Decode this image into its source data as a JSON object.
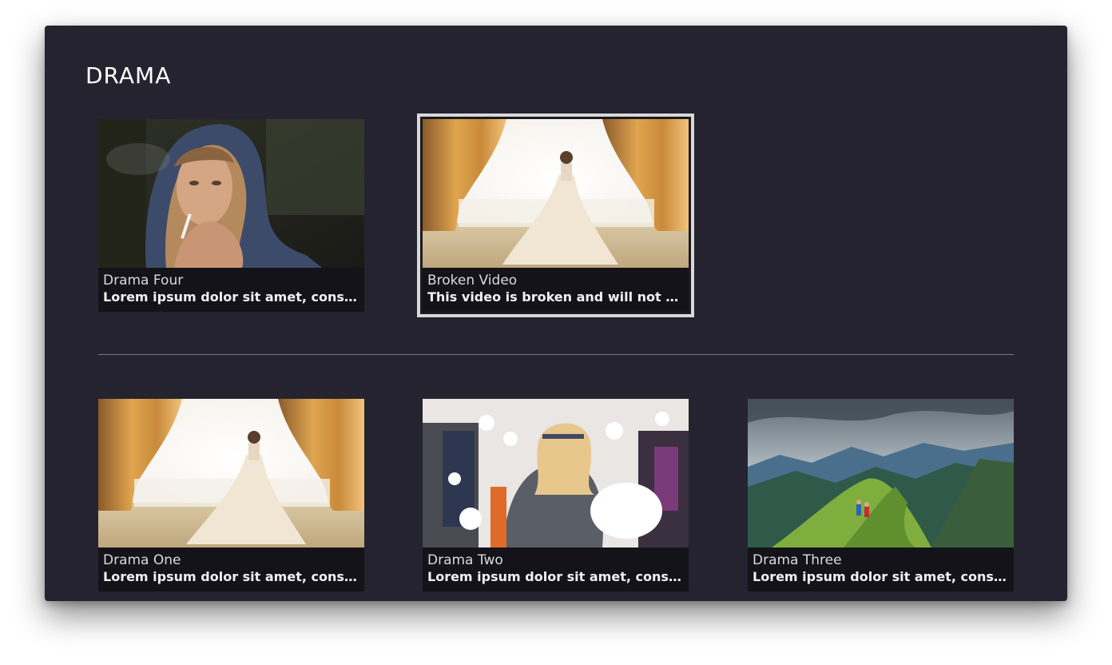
{
  "section": {
    "title": "DRAMA"
  },
  "rows": [
    {
      "tiles": [
        {
          "title": "Drama Four",
          "description": "Lorem ipsum dolor sit amet, consectetur adipiscing elit",
          "image": "woman-hood-smoking-photo",
          "focused": false
        },
        {
          "title": "Broken Video",
          "description": "This video is broken and will not play",
          "image": "bride-window-photo",
          "focused": true
        }
      ]
    },
    {
      "tiles": [
        {
          "title": "Drama One",
          "description": "Lorem ipsum dolor sit amet, consectetur adipiscing elit",
          "image": "bride-window-photo",
          "focused": false
        },
        {
          "title": "Drama Two",
          "description": "Lorem ipsum dolor sit amet, consectetur adipiscing elit",
          "image": "pillow-fight-photo",
          "focused": false
        },
        {
          "title": "Drama Three",
          "description": "Lorem ipsum dolor sit amet, consectetur adipiscing elit",
          "image": "mountain-hikers-photo",
          "focused": false
        }
      ]
    }
  ],
  "colors": {
    "background": "#24232f",
    "tile_caption_bg": "#141319",
    "focus_border": "#d8d8d8"
  }
}
